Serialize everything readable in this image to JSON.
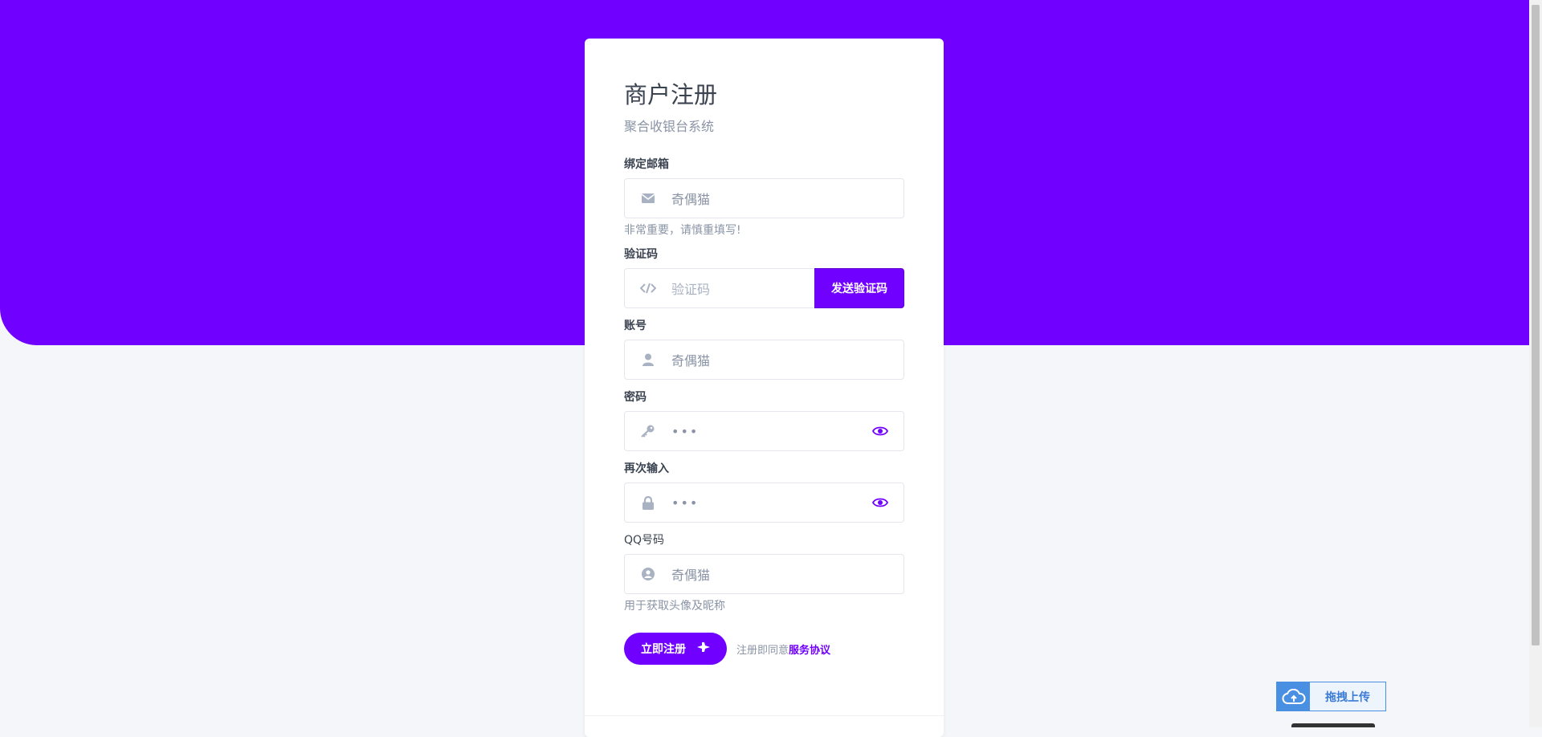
{
  "page": {
    "title": "商户注册",
    "subtitle": "聚合收银台系统"
  },
  "colors": {
    "accent": "#7000ff",
    "background": "#f5f6fa",
    "muted_text": "#8a94a6"
  },
  "form": {
    "email": {
      "label": "绑定邮箱",
      "value": "奇偶猫",
      "hint": "非常重要，请慎重填写!",
      "icon": "envelope-icon"
    },
    "code": {
      "label": "验证码",
      "placeholder": "验证码",
      "icon": "code-icon",
      "send_button": "发送验证码"
    },
    "account": {
      "label": "账号",
      "value": "奇偶猫",
      "icon": "user-icon"
    },
    "password": {
      "label": "密码",
      "value": "•••",
      "icon": "key-icon",
      "toggle_icon": "eye-icon"
    },
    "password_confirm": {
      "label": "再次输入",
      "value": "•••",
      "icon": "lock-icon",
      "toggle_icon": "eye-icon"
    },
    "qq": {
      "label": "QQ号码",
      "value": "奇偶猫",
      "hint": "用于获取头像及昵称",
      "icon": "user-circle-icon"
    },
    "submit_label": "立即注册",
    "agree_prefix": "注册即同意",
    "agree_link": "服务协议"
  },
  "upload_widget": {
    "label": "拖拽上传",
    "icon": "cloud-upload-icon"
  }
}
